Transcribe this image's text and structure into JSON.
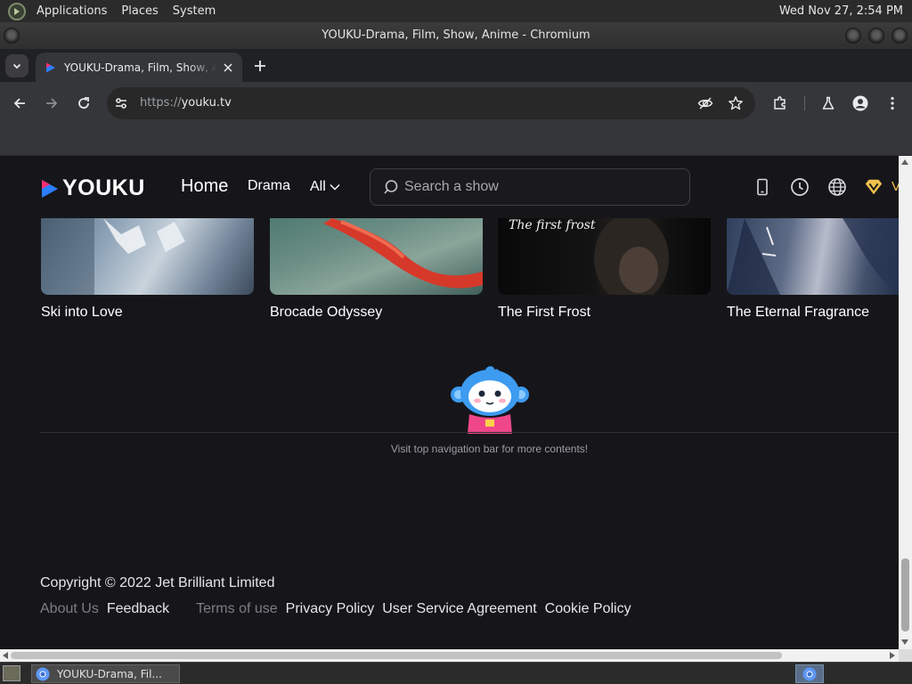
{
  "system_panel": {
    "menus": [
      "Applications",
      "Places",
      "System"
    ],
    "clock": "Wed Nov 27,  2:54 PM"
  },
  "window": {
    "title": "YOUKU-Drama, Film, Show, Anime - Chromium"
  },
  "browser": {
    "tab": {
      "title": "YOUKU-Drama, Film, Show, Anime - Chromium",
      "favicon": "youku-play-icon"
    },
    "url_scheme": "https://",
    "url_host": "youku.tv"
  },
  "site": {
    "logo_text": "YOUKU",
    "nav": {
      "home": "Home",
      "drama": "Drama",
      "all": "All"
    },
    "search_placeholder": "Search a show",
    "header_icons": [
      "mobile-icon",
      "history-icon",
      "globe-icon",
      "vip-gem-icon"
    ],
    "vip_label_partial": "V"
  },
  "posters": [
    {
      "title": "Ski into Love"
    },
    {
      "title": "Brocade Odyssey"
    },
    {
      "title": "The First Frost",
      "overlay_text": "The first frost"
    },
    {
      "title": "The Eternal Fragrance"
    }
  ],
  "end_of_list": {
    "message": "Visit top navigation bar for more contents!"
  },
  "footer": {
    "copyright": "Copyright © 2022 Jet Brilliant Limited",
    "links": [
      {
        "label": "About Us",
        "style": "dim"
      },
      {
        "label": "Feedback",
        "style": "bright"
      },
      {
        "label": "Terms of use",
        "style": "dim"
      },
      {
        "label": "Privacy Policy",
        "style": "bright"
      },
      {
        "label": "User Service Agreement",
        "style": "bright"
      },
      {
        "label": "Cookie Policy",
        "style": "bright"
      }
    ]
  },
  "taskbar": {
    "window_button": "YOUKU-Drama, Fil..."
  },
  "colors": {
    "page_bg": "#16161a",
    "youku_blue": "#2b7fff",
    "youku_pink": "#ff2d72",
    "vip_gold": "#f2c24e"
  }
}
